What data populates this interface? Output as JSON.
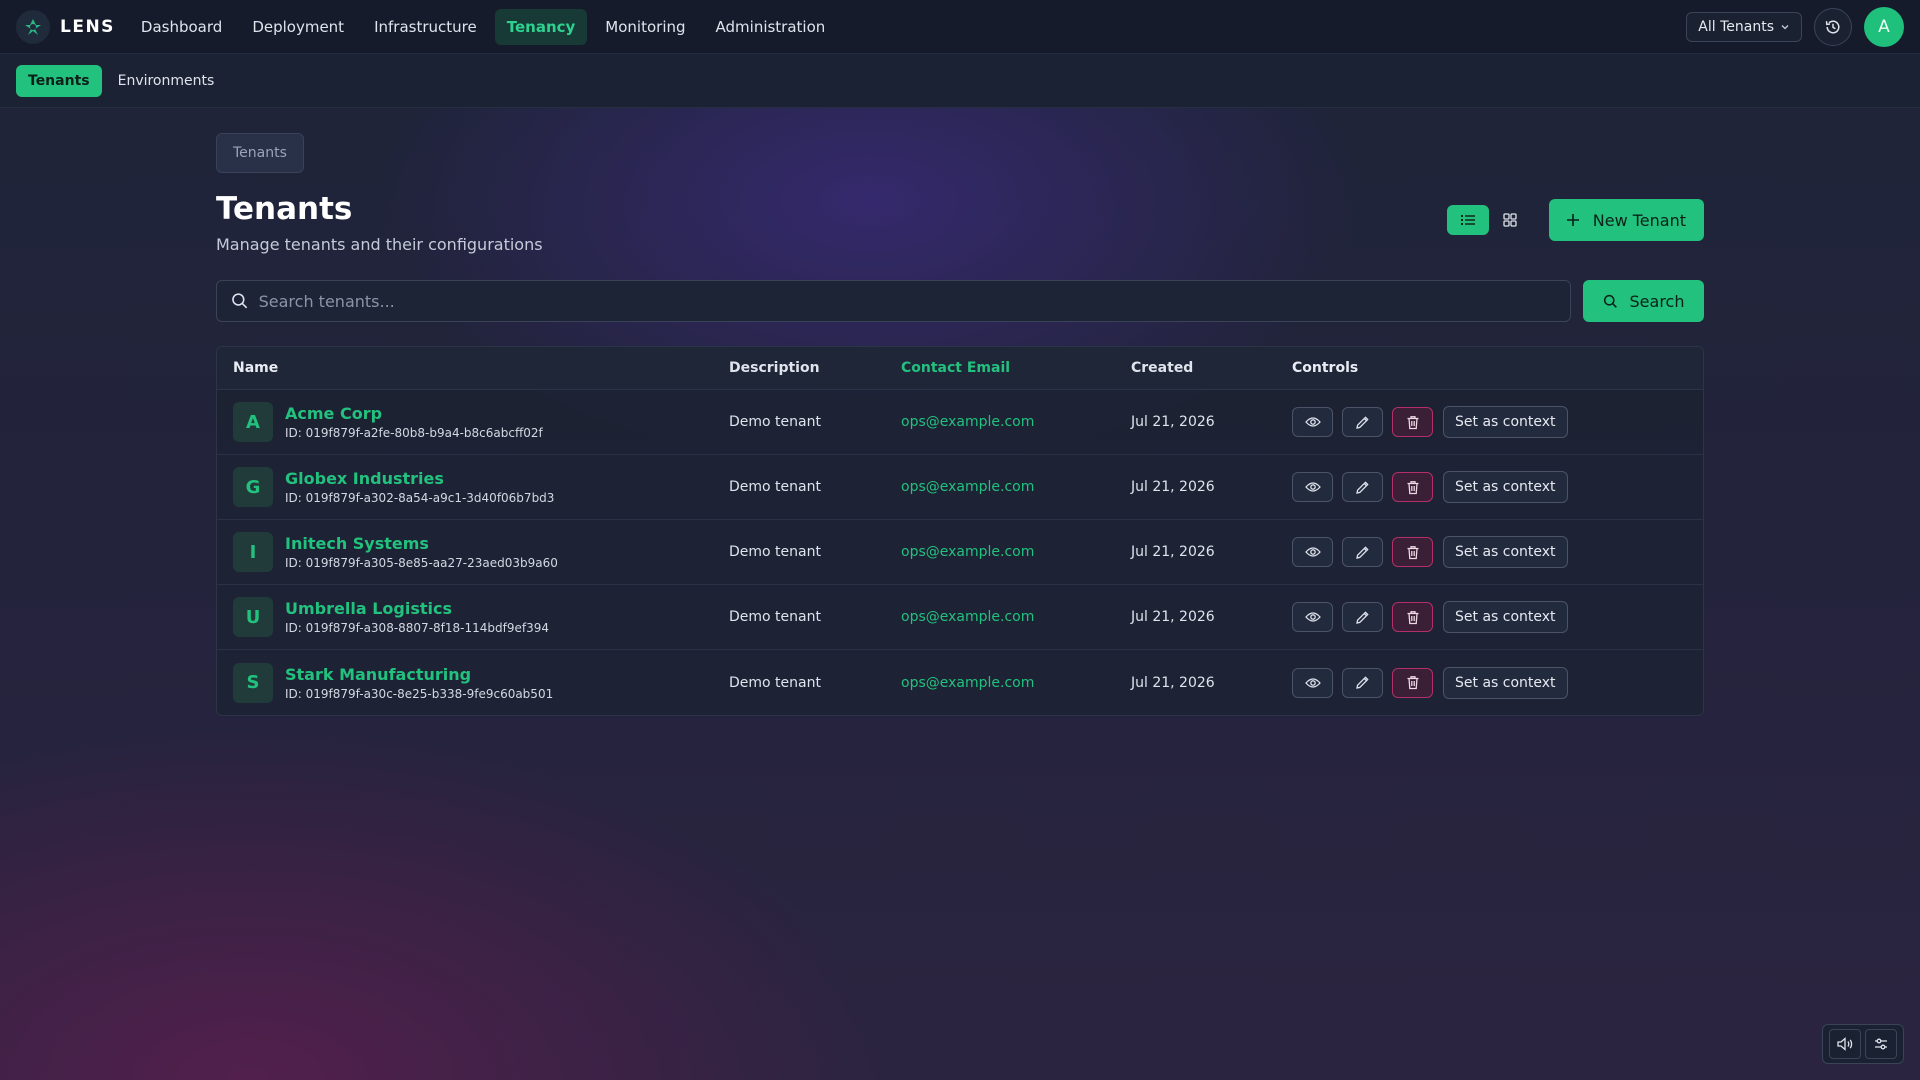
{
  "app": {
    "name": "LENS"
  },
  "nav": {
    "items": [
      "Dashboard",
      "Deployment",
      "Infrastructure",
      "Tenancy",
      "Monitoring",
      "Administration"
    ],
    "active": "Tenancy"
  },
  "header": {
    "tenant_selector": "All Tenants",
    "avatar_initial": "A"
  },
  "subnav": {
    "items": [
      "Tenants",
      "Environments"
    ],
    "active": "Tenants"
  },
  "breadcrumb": "Tenants",
  "page": {
    "title": "Tenants",
    "subtitle": "Manage tenants and their configurations"
  },
  "toolbar": {
    "new_tenant_label": "New Tenant",
    "view_mode": "list"
  },
  "search": {
    "placeholder": "Search tenants...",
    "value": "",
    "button_label": "Search"
  },
  "table": {
    "columns": [
      "Name",
      "Description",
      "Contact Email",
      "Created",
      "Controls"
    ],
    "context_button_label": "Set as context",
    "rows": [
      {
        "initial": "A",
        "name": "Acme Corp",
        "id": "ID: 019f879f-a2fe-80b8-b9a4-b8c6abcff02f",
        "description": "Demo tenant",
        "email": "ops@example.com",
        "created": "Jul 21, 2026"
      },
      {
        "initial": "G",
        "name": "Globex Industries",
        "id": "ID: 019f879f-a302-8a54-a9c1-3d40f06b7bd3",
        "description": "Demo tenant",
        "email": "ops@example.com",
        "created": "Jul 21, 2026"
      },
      {
        "initial": "I",
        "name": "Initech Systems",
        "id": "ID: 019f879f-a305-8e85-aa27-23aed03b9a60",
        "description": "Demo tenant",
        "email": "ops@example.com",
        "created": "Jul 21, 2026"
      },
      {
        "initial": "U",
        "name": "Umbrella Logistics",
        "id": "ID: 019f879f-a308-8807-8f18-114bdf9ef394",
        "description": "Demo tenant",
        "email": "ops@example.com",
        "created": "Jul 21, 2026"
      },
      {
        "initial": "S",
        "name": "Stark Manufacturing",
        "id": "ID: 019f879f-a30c-8e25-b338-9fe9c60ab501",
        "description": "Demo tenant",
        "email": "ops@example.com",
        "created": "Jul 21, 2026"
      }
    ]
  },
  "colors": {
    "accent": "#22c17e",
    "danger": "#b42f69",
    "topbar": "#151b2b"
  },
  "icons": [
    "lens-logo-icon",
    "chevron-down-icon",
    "history-icon",
    "list-view-icon",
    "grid-view-icon",
    "plus-icon",
    "search-icon",
    "eye-icon",
    "pencil-icon",
    "trash-icon",
    "volume-icon",
    "sliders-icon"
  ]
}
